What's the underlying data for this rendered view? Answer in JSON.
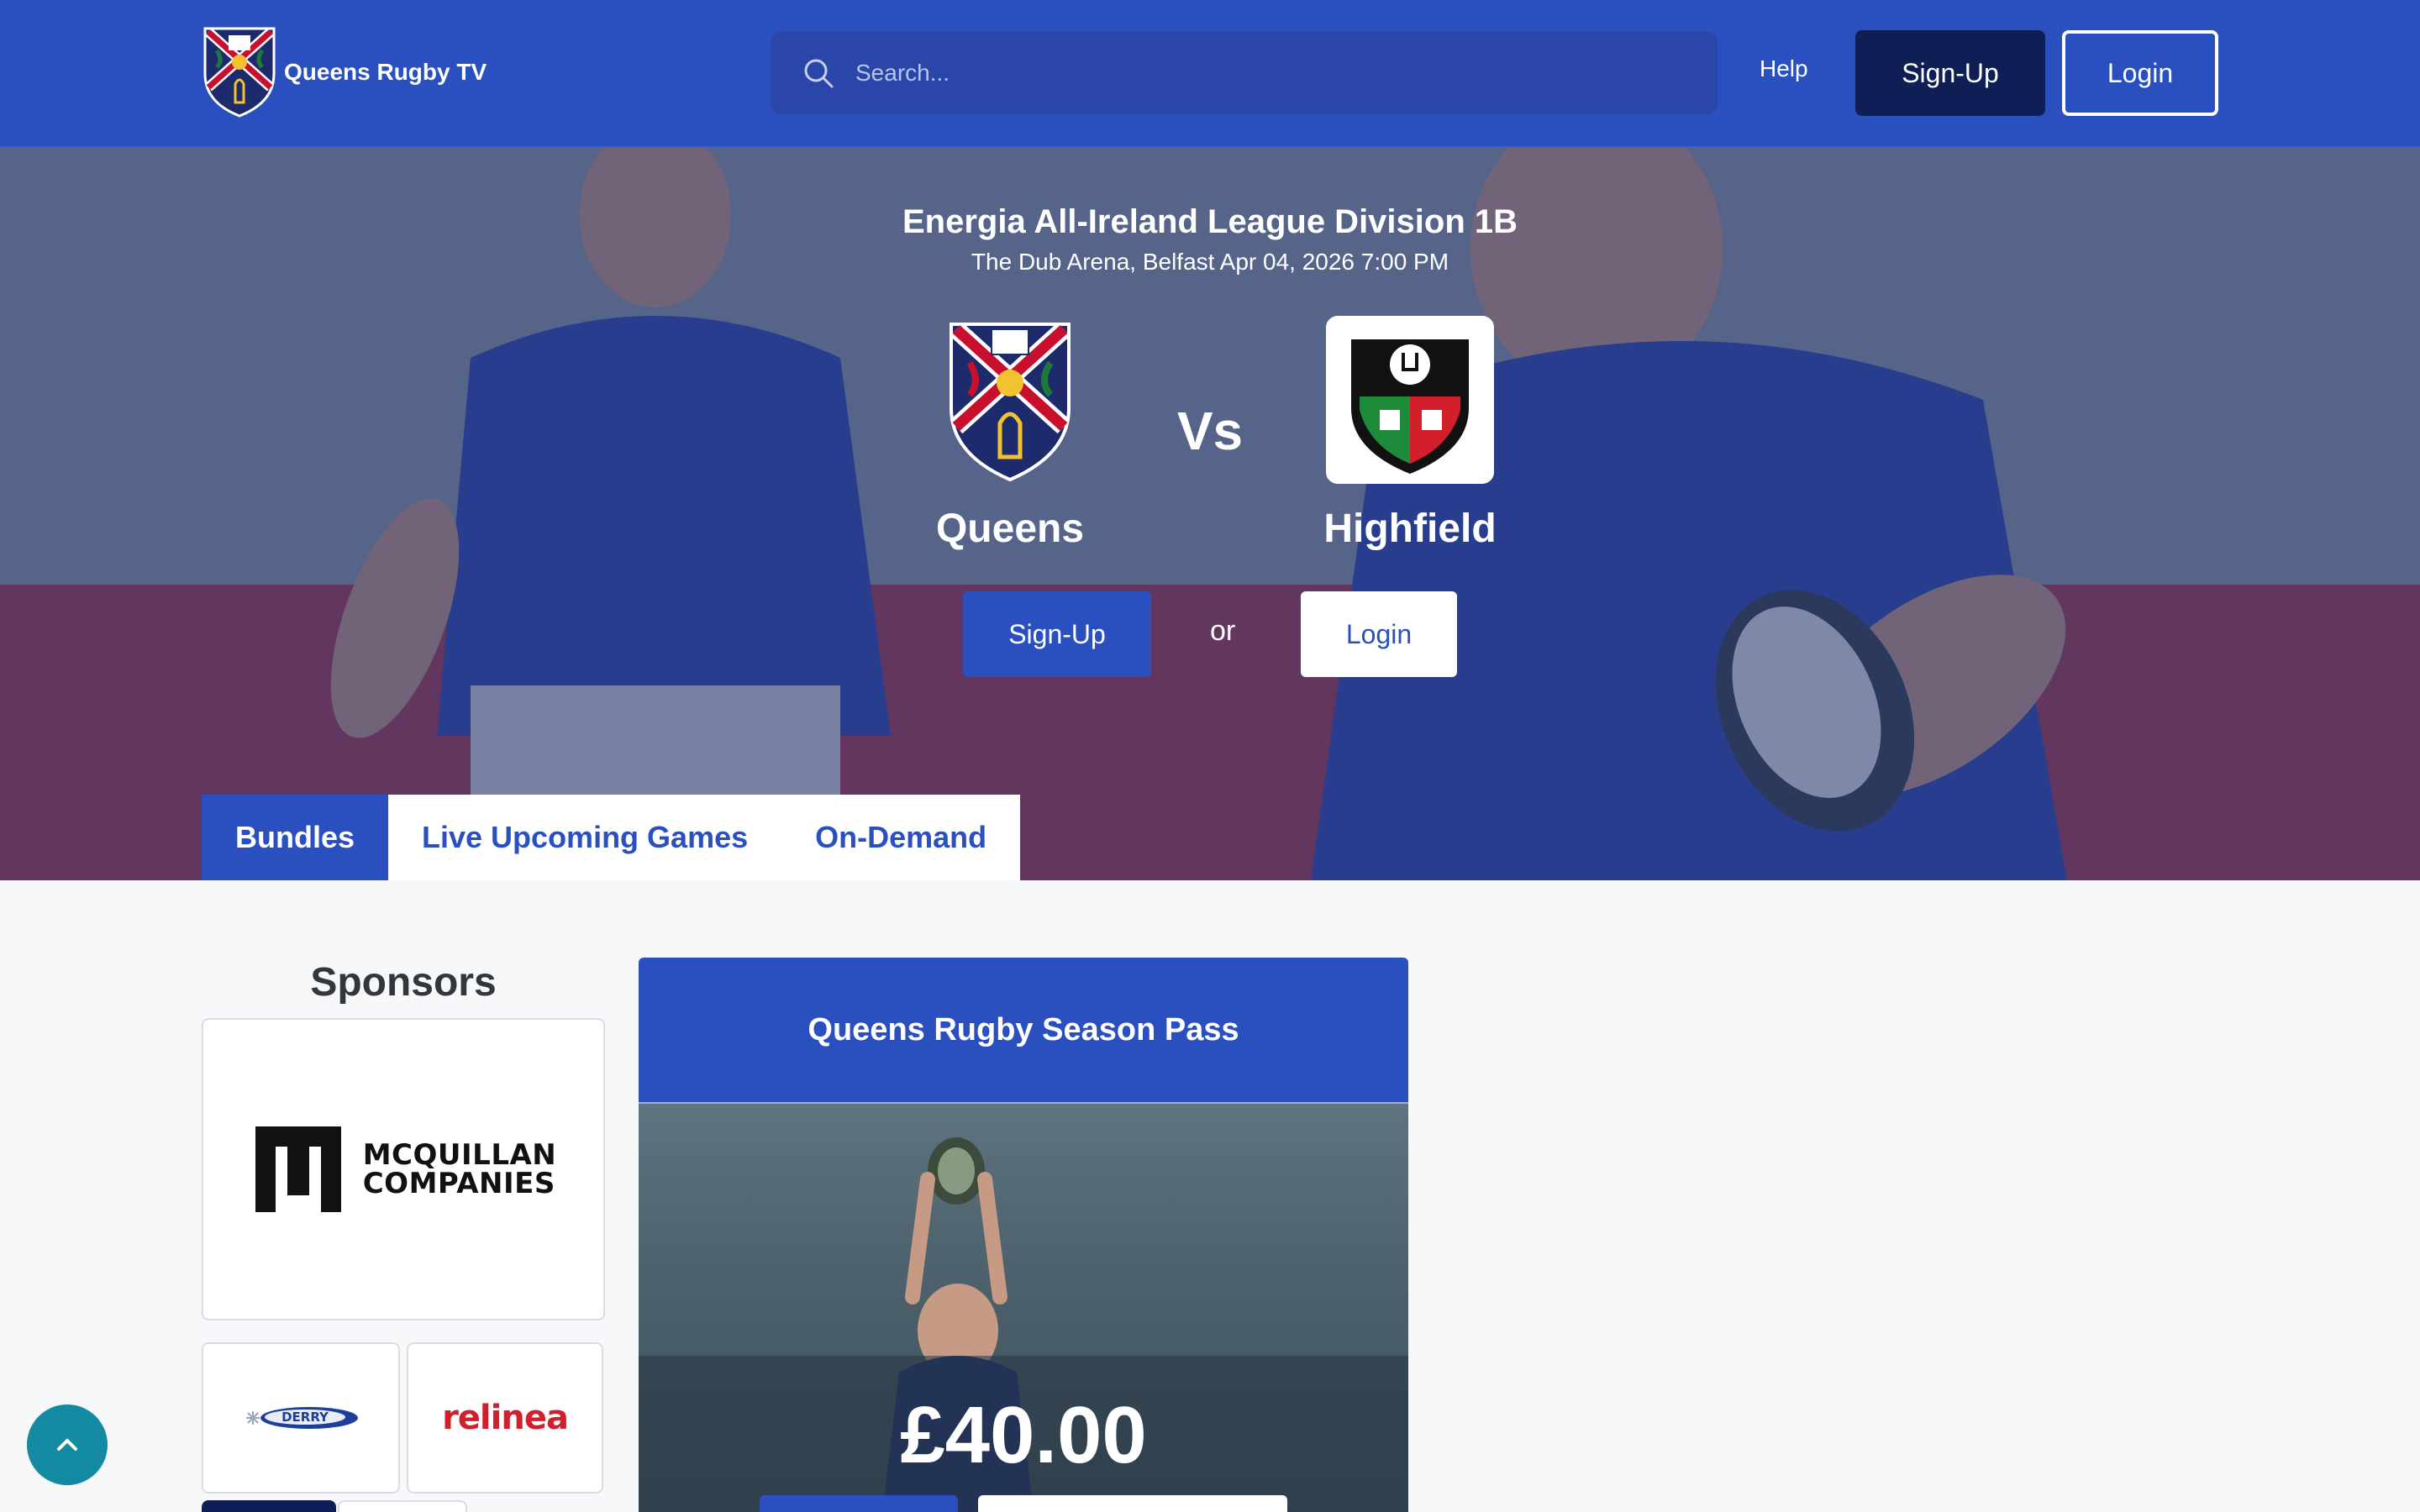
{
  "header": {
    "brand_name": "Queens Rugby TV",
    "search_placeholder": "Search...",
    "help_label": "Help",
    "signup_label": "Sign-Up",
    "login_label": "Login"
  },
  "match": {
    "league": "Energia All-Ireland League Division 1B",
    "venue_datetime": "The Dub Arena, Belfast Apr 04, 2026 7:00 PM",
    "home_team": "Queens",
    "away_team": "Highfield",
    "vs_label": "Vs",
    "signup_label": "Sign-Up",
    "or_label": "or",
    "login_label": "Login"
  },
  "tabs": [
    {
      "label": "Bundles",
      "active": true
    },
    {
      "label": "Live Upcoming Games",
      "active": false
    },
    {
      "label": "On-Demand",
      "active": false
    }
  ],
  "sponsors": {
    "title": "Sponsors",
    "main_name_line1": "MCQUILLAN",
    "main_name_line2": "COMPANIES",
    "derry_name": "DERRY",
    "relinea_name": "relinea"
  },
  "season_pass": {
    "title": "Queens Rugby Season Pass",
    "price": "£40.00"
  },
  "colors": {
    "brand_blue": "#2a4fbe",
    "navy": "#0f1f55",
    "scroll_button": "#138aa1",
    "relinea_red": "#d0202e"
  },
  "icons": {
    "search": "search-icon",
    "scroll_top": "chevron-up-icon"
  }
}
